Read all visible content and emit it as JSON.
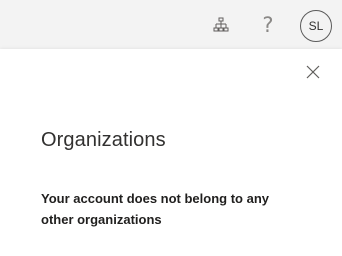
{
  "header": {
    "icons": [
      {
        "name": "org-chart-icon"
      },
      {
        "name": "help-icon",
        "glyph": "?"
      }
    ],
    "avatar_initials": "SL"
  },
  "panel": {
    "close_icon": "close-icon",
    "title": "Organizations",
    "message": "Your account does not belong to any other organizations"
  },
  "colors": {
    "topbar_bg": "#f3f3f3",
    "panel_bg": "#ffffff",
    "text_primary": "#323130",
    "icon_gray": "#605e5c"
  }
}
